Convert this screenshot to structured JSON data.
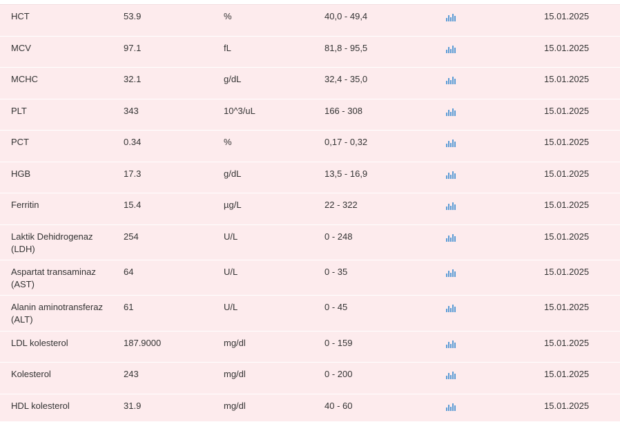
{
  "rows": [
    {
      "name": "HCT",
      "value": "53.9",
      "unit": "%",
      "range": "40,0 - 49,4",
      "date": "15.01.2025",
      "chart_icon": "bar-chart-icon"
    },
    {
      "name": "MCV",
      "value": "97.1",
      "unit": "fL",
      "range": "81,8 - 95,5",
      "date": "15.01.2025",
      "chart_icon": "bar-chart-icon"
    },
    {
      "name": "MCHC",
      "value": "32.1",
      "unit": "g/dL",
      "range": "32,4 - 35,0",
      "date": "15.01.2025",
      "chart_icon": "bar-chart-icon"
    },
    {
      "name": "PLT",
      "value": "343",
      "unit": "10^3/uL",
      "range": "166 - 308",
      "date": "15.01.2025",
      "chart_icon": "bar-chart-icon"
    },
    {
      "name": "PCT",
      "value": "0.34",
      "unit": "%",
      "range": "0,17 - 0,32",
      "date": "15.01.2025",
      "chart_icon": "bar-chart-icon"
    },
    {
      "name": "HGB",
      "value": "17.3",
      "unit": "g/dL",
      "range": "13,5 - 16,9",
      "date": "15.01.2025",
      "chart_icon": "bar-chart-icon"
    },
    {
      "name": "Ferritin",
      "value": "15.4",
      "unit": "µg/L",
      "range": "22 - 322",
      "date": "15.01.2025",
      "chart_icon": "bar-chart-icon"
    },
    {
      "name": "Laktik Dehidrogenaz (LDH)",
      "value": "254",
      "unit": "U/L",
      "range": "0 - 248",
      "date": "15.01.2025",
      "chart_icon": "bar-chart-icon"
    },
    {
      "name": "Aspartat transaminaz (AST)",
      "value": "64",
      "unit": "U/L",
      "range": "0 - 35",
      "date": "15.01.2025",
      "chart_icon": "bar-chart-icon"
    },
    {
      "name": "Alanin aminotransferaz (ALT)",
      "value": "61",
      "unit": "U/L",
      "range": "0 - 45",
      "date": "15.01.2025",
      "chart_icon": "bar-chart-icon"
    },
    {
      "name": "LDL kolesterol",
      "value": "187.9000",
      "unit": "mg/dl",
      "range": "0 - 159",
      "date": "15.01.2025",
      "chart_icon": "bar-chart-icon"
    },
    {
      "name": "Kolesterol",
      "value": "243",
      "unit": "mg/dl",
      "range": "0 - 200",
      "date": "15.01.2025",
      "chart_icon": "bar-chart-icon"
    },
    {
      "name": "HDL kolesterol",
      "value": "31.9",
      "unit": "mg/dl",
      "range": "40 - 60",
      "date": "15.01.2025",
      "chart_icon": "bar-chart-icon"
    }
  ],
  "colors": {
    "row_background": "#fdebed",
    "row_divider": "#ffffff",
    "text": "#333333",
    "chart_icon": "#5a9bd5"
  }
}
